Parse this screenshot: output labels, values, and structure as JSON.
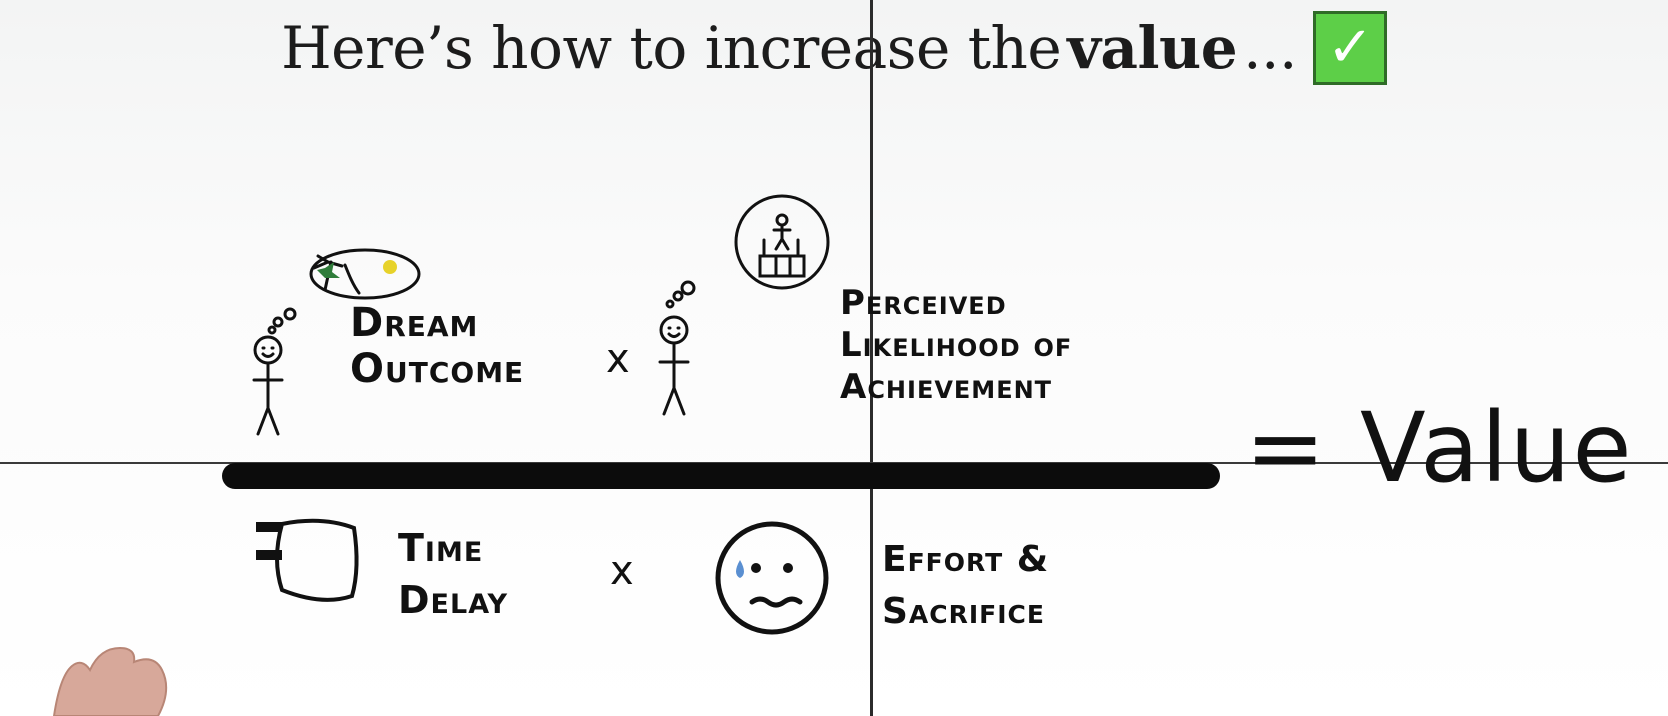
{
  "headline": {
    "prefix": "Here’s how to increase the",
    "emphasis": "value",
    "suffix": "...",
    "check_icon": "check-icon",
    "check_color": "#5dcf48"
  },
  "numerator": {
    "left": {
      "line1": "Dream",
      "line2": "Outcome"
    },
    "operator": "x",
    "right": {
      "line1": "Perceived",
      "line2": "Likelihood of",
      "line3": "Achievement"
    }
  },
  "denominator": {
    "left": {
      "line1": "Time",
      "line2": "Delay"
    },
    "operator": "x",
    "right": {
      "line1": "Effort &",
      "line2": "Sacrifice"
    }
  },
  "result": {
    "equals": "=",
    "label": "Value"
  }
}
